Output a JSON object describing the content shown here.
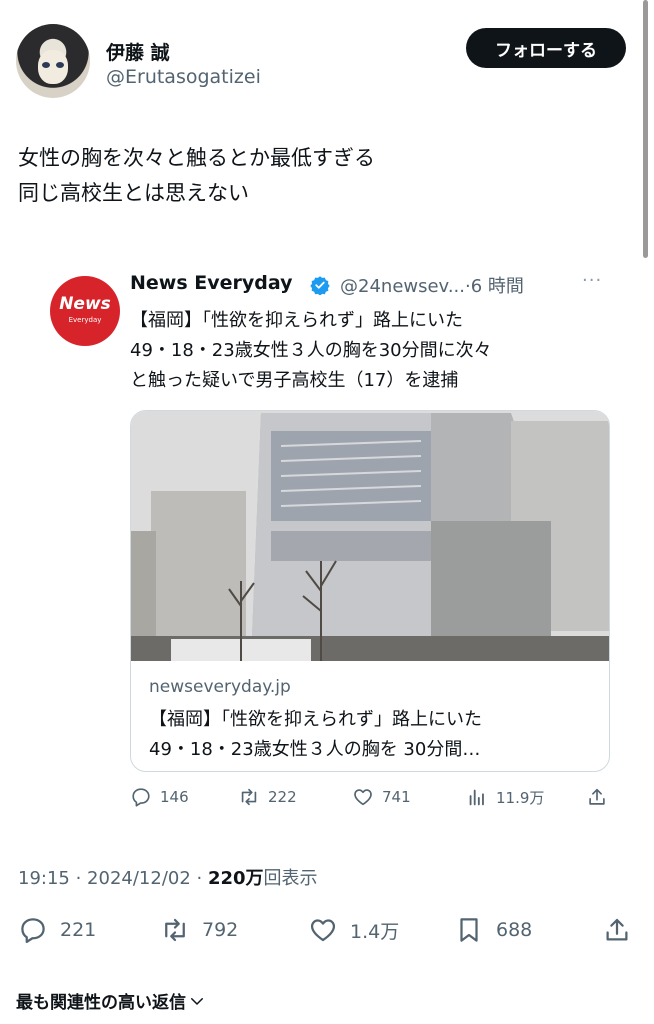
{
  "author": {
    "name": "伊藤 誠",
    "handle": "@Erutasogatizei",
    "follow_label": "フォローする"
  },
  "tweet": {
    "lines": [
      "女性の胸を次々と触るとか最低すぎる",
      "同じ高校生とは思えない"
    ]
  },
  "quoted": {
    "avatar_text": "News",
    "avatar_subtext": "Everyday",
    "name": "News Everyday",
    "handle_time": "@24newsev...·6 時間",
    "more": "···",
    "lines": [
      "【福岡】「性欲を抑えられず」路上にいた",
      "49・18・23歳女性３人の胸を30分間に次々",
      "と触った疑いで男子高校生（17）を逮捕"
    ],
    "card": {
      "domain": "newseveryday.jp",
      "title_lines": [
        "【福岡】「性欲を抑えられず」路上にいた",
        "49・18・23歳女性３人の胸を 30分間…"
      ]
    },
    "stats": {
      "replies": "146",
      "reposts": "222",
      "likes": "741",
      "views": "11.9万"
    }
  },
  "meta": {
    "time_date": "19:15 · 2024/12/02 · ",
    "views_count": "220万",
    "views_label": "回表示"
  },
  "actions": {
    "replies": "221",
    "reposts": "792",
    "likes": "1.4万",
    "bookmarks": "688"
  },
  "reply_sort": {
    "label": "最も関連性の高い返信"
  },
  "colors": {
    "text": "#0f1419",
    "secondary": "#536471",
    "verified": "#1d9bf0",
    "news_red": "#d7242b",
    "follow_bg": "#0f1419"
  }
}
